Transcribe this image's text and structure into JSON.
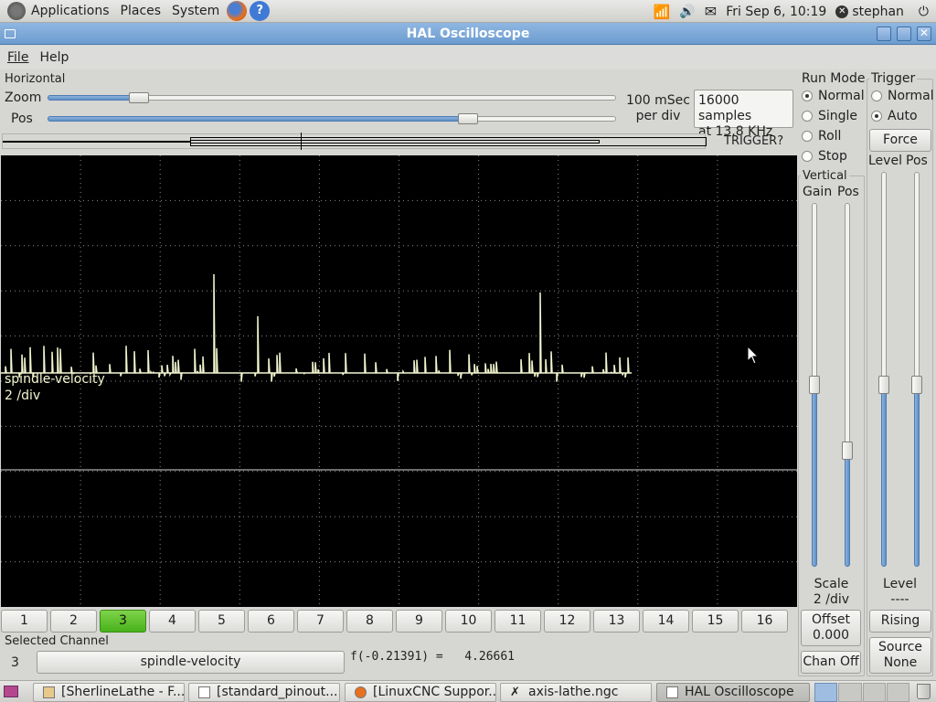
{
  "top_panel": {
    "menus": [
      "Applications",
      "Places",
      "System"
    ],
    "clock": "Fri Sep  6, 10:19",
    "user": "stephan"
  },
  "window": {
    "title": "HAL Oscilloscope"
  },
  "menubar": {
    "file": "File",
    "help": "Help"
  },
  "horizontal": {
    "label": "Horizontal",
    "zoom_label": "Zoom",
    "pos_label": "Pos",
    "zoom_value": 0.16,
    "pos_value": 0.74,
    "rate_line1": "100 mSec",
    "rate_line2": "per div",
    "samples_line1": "16000 samples",
    "samples_line2": "at 13.8 KHz",
    "trigger_status": "TRIGGER?"
  },
  "run_mode": {
    "label": "Run Mode",
    "options": [
      "Normal",
      "Single",
      "Roll",
      "Stop"
    ],
    "selected": "Normal"
  },
  "vertical": {
    "label": "Vertical",
    "gain_label": "Gain",
    "pos_label": "Pos",
    "gain_value": 0.5,
    "pos_value": 0.32,
    "scale_label": "Scale",
    "scale_value": "2 /div",
    "offset_label": "Offset",
    "offset_value": "0.000",
    "chan_off_label": "Chan Off"
  },
  "trigger": {
    "label": "Trigger",
    "options": [
      "Normal",
      "Auto"
    ],
    "selected": "Auto",
    "force_label": "Force",
    "level_label": "Level",
    "pos_label": "Pos",
    "level_slider": 0.46,
    "pos_slider": 0.46,
    "level_title": "Level",
    "level_value": "----",
    "edge_label": "Rising",
    "source_label": "Source",
    "source_value": "None"
  },
  "scope": {
    "channel_name": "spindle-velocity",
    "channel_scale": "2 /div"
  },
  "channels": [
    "1",
    "2",
    "3",
    "4",
    "5",
    "6",
    "7",
    "8",
    "9",
    "10",
    "11",
    "12",
    "13",
    "14",
    "15",
    "16"
  ],
  "selected_channel_index": 2,
  "selected_channel": {
    "label": "Selected Channel",
    "number": "3",
    "name": "spindle-velocity",
    "readout": "f(-0.21391) =   4.26661"
  },
  "taskbar": {
    "tasks": [
      "[SherlineLathe - F...",
      "[standard_pinout....",
      "[LinuxCNC Suppor...",
      "axis-lathe.ngc",
      "HAL Oscilloscope"
    ]
  },
  "colors": {
    "trace": "#f4f7d0",
    "selected_channel": "#47b21b",
    "titlebar": "#6d9ccf"
  }
}
